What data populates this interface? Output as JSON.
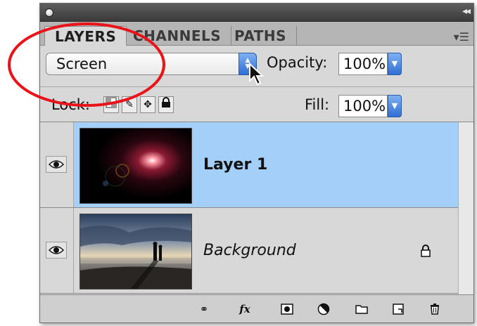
{
  "tabs": [
    {
      "label": "LAYERS",
      "active": true
    },
    {
      "label": "CHANNELS",
      "active": false
    },
    {
      "label": "PATHS",
      "active": false
    }
  ],
  "blend_mode": {
    "selected": "Screen"
  },
  "opacity": {
    "label": "Opacity:",
    "value": "100%"
  },
  "lock": {
    "label": "Lock:"
  },
  "fill": {
    "label": "Fill:",
    "value": "100%"
  },
  "layers": [
    {
      "name": "Layer 1",
      "selected": true,
      "visible": true,
      "locked": false
    },
    {
      "name": "Background",
      "selected": false,
      "visible": true,
      "locked": true
    }
  ],
  "colors": {
    "selection": "#a4cff8",
    "stepper": "#2f6fd4",
    "annotation": "#e8141a"
  }
}
